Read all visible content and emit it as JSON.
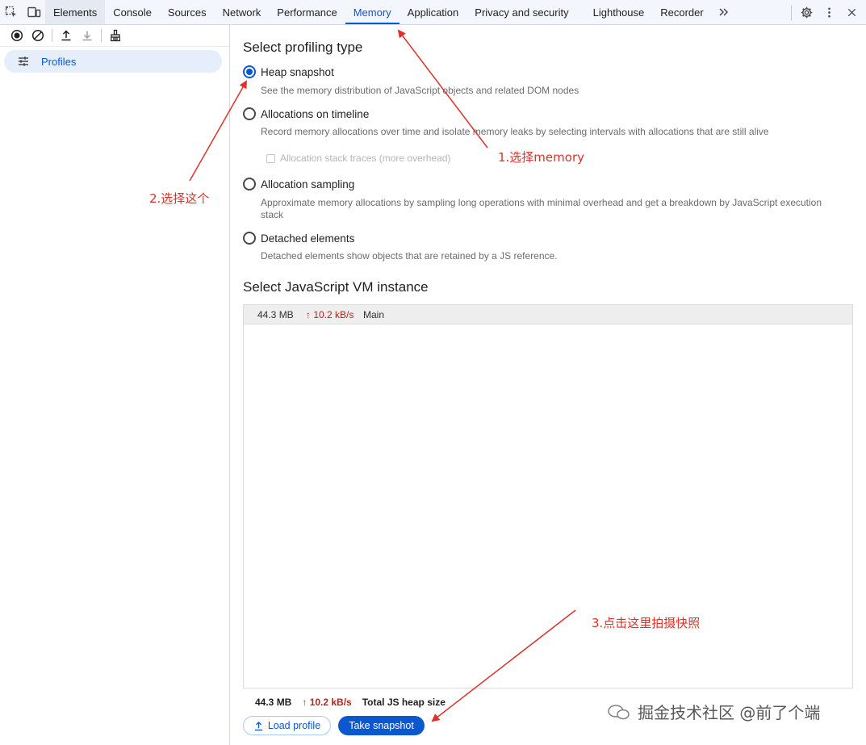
{
  "tabs": [
    {
      "label": "Elements"
    },
    {
      "label": "Console"
    },
    {
      "label": "Sources"
    },
    {
      "label": "Network"
    },
    {
      "label": "Performance"
    },
    {
      "label": "Memory",
      "active": true
    },
    {
      "label": "Application"
    },
    {
      "label": "Privacy and security"
    },
    {
      "label": "Lighthouse"
    },
    {
      "label": "Recorder"
    }
  ],
  "sidebar": {
    "items": [
      {
        "label": "Profiles"
      }
    ]
  },
  "main": {
    "heading_profiling": "Select profiling type",
    "options": [
      {
        "label": "Heap snapshot",
        "description": "See the memory distribution of JavaScript objects and related DOM nodes",
        "checked": true
      },
      {
        "label": "Allocations on timeline",
        "description": "Record memory allocations over time and isolate memory leaks by selecting intervals with allocations that are still alive",
        "checked": false
      },
      {
        "label": "Allocation sampling",
        "description": "Approximate memory allocations by sampling long operations with minimal overhead and get a breakdown by JavaScript execution stack",
        "checked": false
      },
      {
        "label": "Detached elements",
        "description": "Detached elements show objects that are retained by a JS reference.",
        "checked": false
      }
    ],
    "stack_traces_checkbox": "Allocation stack traces (more overhead)",
    "heading_vm": "Select JavaScript VM instance",
    "vm_row": {
      "size": "44.3 MB",
      "rate": "↑ 10.2 kB/s",
      "name": "Main"
    },
    "footer": {
      "size": "44.3 MB",
      "rate": "↑ 10.2 kB/s",
      "label": "Total JS heap size"
    },
    "buttons": {
      "load": "Load profile",
      "take": "Take snapshot"
    }
  },
  "annotations": {
    "step1": "1.选择memory",
    "step2": "2.选择这个",
    "step3": "3.点击这里拍摄快照"
  },
  "watermark": "掘金技术社区 @前了个端",
  "colors": {
    "accent": "#0b57d0",
    "annotation": "#e0302a",
    "rate": "#b3261e"
  }
}
